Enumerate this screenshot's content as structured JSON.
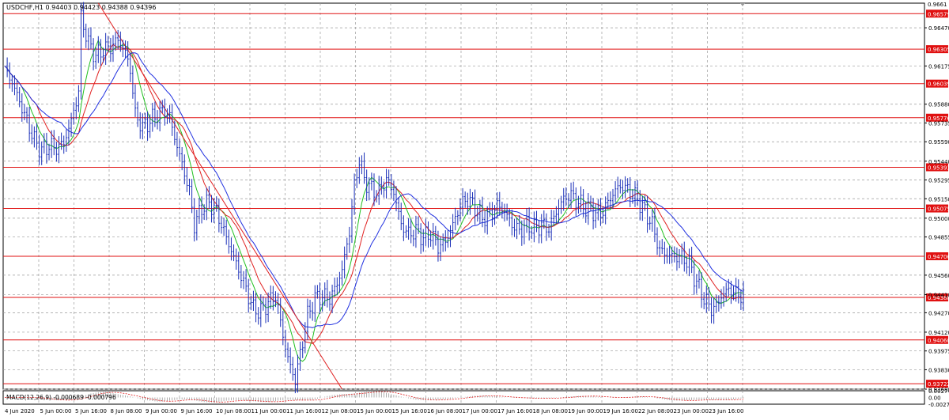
{
  "window": {
    "title": "USDCHF,H1  0.94403 0.94423 0.94388 0.94396"
  },
  "colors": {
    "background": "#ffffff",
    "grid": "#9a9a9a",
    "candle": "#1a2fb8",
    "level_line": "#e01010",
    "level_label_bg": "#e01010",
    "level_label_text": "#ffffff",
    "ma_fast": "#20c020",
    "ma_mid": "#e02020",
    "ma_slow": "#2030e0",
    "trendline": "#e02020",
    "macd_hist": "#9a9a9a",
    "macd_signal": "#e02020",
    "axis_text": "#000000"
  },
  "chart_data": [
    {
      "type": "line",
      "title": "USDCHF,H1  0.94403 0.94423 0.94388 0.94396",
      "ylim": [
        0.9368,
        0.9666
      ],
      "grid": true,
      "x_labels": [
        "4 Jun 2020",
        "5 Jun 00:00",
        "5 Jun 16:00",
        "8 Jun 08:00",
        "9 Jun 00:00",
        "9 Jun 16:00",
        "10 Jun 08:00",
        "11 Jun 00:00",
        "11 Jun 16:00",
        "12 Jun 08:00",
        "15 Jun 00:00",
        "15 Jun 16:00",
        "16 Jun 08:00",
        "17 Jun 00:00",
        "17 Jun 16:00",
        "18 Jun 08:00",
        "19 Jun 00:00",
        "19 Jun 16:00",
        "22 Jun 08:00",
        "23 Jun 00:00",
        "23 Jun 16:00"
      ],
      "y_ticks": [
        "0.96470",
        "0.96175",
        "0.95880",
        "0.95735",
        "0.95590",
        "0.95440",
        "0.95295",
        "0.95150",
        "0.95000",
        "0.94855",
        "0.94560",
        "0.94410",
        "0.94270",
        "0.94120",
        "0.93975",
        "0.93830",
        "0.93680"
      ],
      "level_lines": [
        "0.96579",
        "0.96305",
        "0.96039",
        "0.95776",
        "0.95393",
        "0.95075",
        "0.94706",
        "0.94388",
        "0.94060",
        "0.93722"
      ],
      "top_right_tick": "0.9661",
      "price_path": [
        [
          0,
          0.9615
        ],
        [
          3,
          0.9605
        ],
        [
          6,
          0.959
        ],
        [
          9,
          0.9575
        ],
        [
          12,
          0.956
        ],
        [
          15,
          0.9552
        ],
        [
          18,
          0.9556
        ],
        [
          21,
          0.9554
        ],
        [
          24,
          0.9558
        ],
        [
          27,
          0.9575
        ],
        [
          30,
          0.9598
        ],
        [
          31,
          0.9655
        ],
        [
          34,
          0.9635
        ],
        [
          37,
          0.9625
        ],
        [
          40,
          0.963
        ],
        [
          43,
          0.9632
        ],
        [
          46,
          0.9638
        ],
        [
          49,
          0.9628
        ],
        [
          51,
          0.9615
        ],
        [
          53,
          0.958
        ],
        [
          56,
          0.957
        ],
        [
          59,
          0.9575
        ],
        [
          62,
          0.958
        ],
        [
          65,
          0.9583
        ],
        [
          67,
          0.9578
        ],
        [
          70,
          0.9555
        ],
        [
          73,
          0.9535
        ],
        [
          75,
          0.952
        ],
        [
          77,
          0.9495
        ],
        [
          80,
          0.9508
        ],
        [
          83,
          0.9512
        ],
        [
          86,
          0.9505
        ],
        [
          89,
          0.949
        ],
        [
          92,
          0.9475
        ],
        [
          95,
          0.946
        ],
        [
          98,
          0.9445
        ],
        [
          101,
          0.943
        ],
        [
          104,
          0.9428
        ],
        [
          107,
          0.9435
        ],
        [
          110,
          0.944
        ],
        [
          112,
          0.942
        ],
        [
          114,
          0.94
        ],
        [
          116,
          0.9385
        ],
        [
          118,
          0.9375
        ],
        [
          120,
          0.9395
        ],
        [
          123,
          0.9425
        ],
        [
          126,
          0.9438
        ],
        [
          129,
          0.944
        ],
        [
          132,
          0.9438
        ],
        [
          134,
          0.9445
        ],
        [
          137,
          0.946
        ],
        [
          140,
          0.949
        ],
        [
          142,
          0.9525
        ],
        [
          144,
          0.9545
        ],
        [
          146,
          0.953
        ],
        [
          149,
          0.9522
        ],
        [
          152,
          0.952
        ],
        [
          155,
          0.953
        ],
        [
          158,
          0.952
        ],
        [
          161,
          0.9495
        ],
        [
          164,
          0.9488
        ],
        [
          167,
          0.949
        ],
        [
          170,
          0.9485
        ],
        [
          173,
          0.9488
        ],
        [
          176,
          0.9478
        ],
        [
          179,
          0.9482
        ],
        [
          182,
          0.9495
        ],
        [
          185,
          0.951
        ],
        [
          188,
          0.9515
        ],
        [
          191,
          0.9508
        ],
        [
          194,
          0.95
        ],
        [
          197,
          0.9502
        ],
        [
          200,
          0.951
        ],
        [
          203,
          0.9505
        ],
        [
          206,
          0.9495
        ],
        [
          209,
          0.949
        ],
        [
          212,
          0.9495
        ],
        [
          215,
          0.9492
        ],
        [
          218,
          0.9495
        ],
        [
          221,
          0.9492
        ],
        [
          224,
          0.9505
        ],
        [
          227,
          0.9515
        ],
        [
          230,
          0.9518
        ],
        [
          233,
          0.9512
        ],
        [
          236,
          0.9508
        ],
        [
          239,
          0.9505
        ],
        [
          242,
          0.9503
        ],
        [
          245,
          0.9512
        ],
        [
          248,
          0.9522
        ],
        [
          251,
          0.9525
        ],
        [
          254,
          0.952
        ],
        [
          257,
          0.9515
        ],
        [
          260,
          0.9505
        ],
        [
          263,
          0.9495
        ],
        [
          266,
          0.9475
        ],
        [
          269,
          0.9472
        ],
        [
          272,
          0.947
        ],
        [
          275,
          0.947
        ],
        [
          278,
          0.9465
        ],
        [
          281,
          0.945
        ],
        [
          284,
          0.9438
        ],
        [
          287,
          0.943
        ],
        [
          289,
          0.9432
        ],
        [
          291,
          0.944
        ],
        [
          294,
          0.9445
        ],
        [
          297,
          0.9442
        ],
        [
          300,
          0.944
        ]
      ]
    },
    {
      "type": "bar",
      "title": "MACD(12,26,9) -0.000689 -0.000796",
      "y_ticks": [
        "0.00274",
        "0.00",
        "-0.00277"
      ],
      "ylim": [
        -0.0028,
        0.0028
      ]
    }
  ]
}
